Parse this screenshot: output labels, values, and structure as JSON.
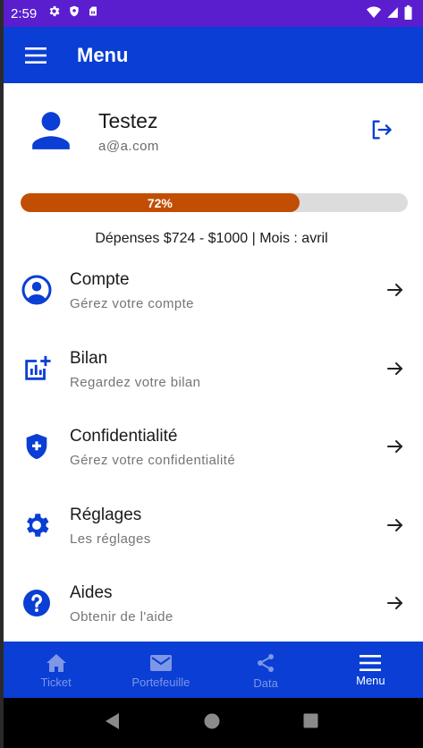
{
  "status_bar": {
    "time": "2:59"
  },
  "app_bar": {
    "title": "Menu"
  },
  "profile": {
    "name": "Testez",
    "email": "a@a.com"
  },
  "budget": {
    "progress_label": "72%",
    "progress_value": 0.72,
    "spend_summary": "Dépenses $724 - $1000  |  Mois : avril"
  },
  "menu": {
    "items": [
      {
        "title": "Compte",
        "subtitle": "Gérez votre compte",
        "icon": "account-circle-icon"
      },
      {
        "title": "Bilan",
        "subtitle": "Regardez votre bilan",
        "icon": "analytics-add-icon"
      },
      {
        "title": "Confidentialité",
        "subtitle": "Gérez votre confidentialité",
        "icon": "shield-plus-icon"
      },
      {
        "title": "Réglages",
        "subtitle": "Les réglages",
        "icon": "gear-icon"
      },
      {
        "title": "Aides",
        "subtitle": "Obtenir de l'aide",
        "icon": "help-icon"
      }
    ]
  },
  "bottom_nav": {
    "items": [
      {
        "label": "Ticket",
        "icon": "home-icon",
        "active": false
      },
      {
        "label": "Portefeuille",
        "icon": "mail-icon",
        "active": false
      },
      {
        "label": "Data",
        "icon": "share-icon",
        "active": false
      },
      {
        "label": "Menu",
        "icon": "menu-icon",
        "active": true
      }
    ]
  },
  "colors": {
    "primary": "#0a3ed4",
    "status_bar": "#5a1ecf",
    "progress": "#c24e04",
    "progress_track": "#dcdcdc",
    "nav_inactive": "#7e97e6"
  }
}
